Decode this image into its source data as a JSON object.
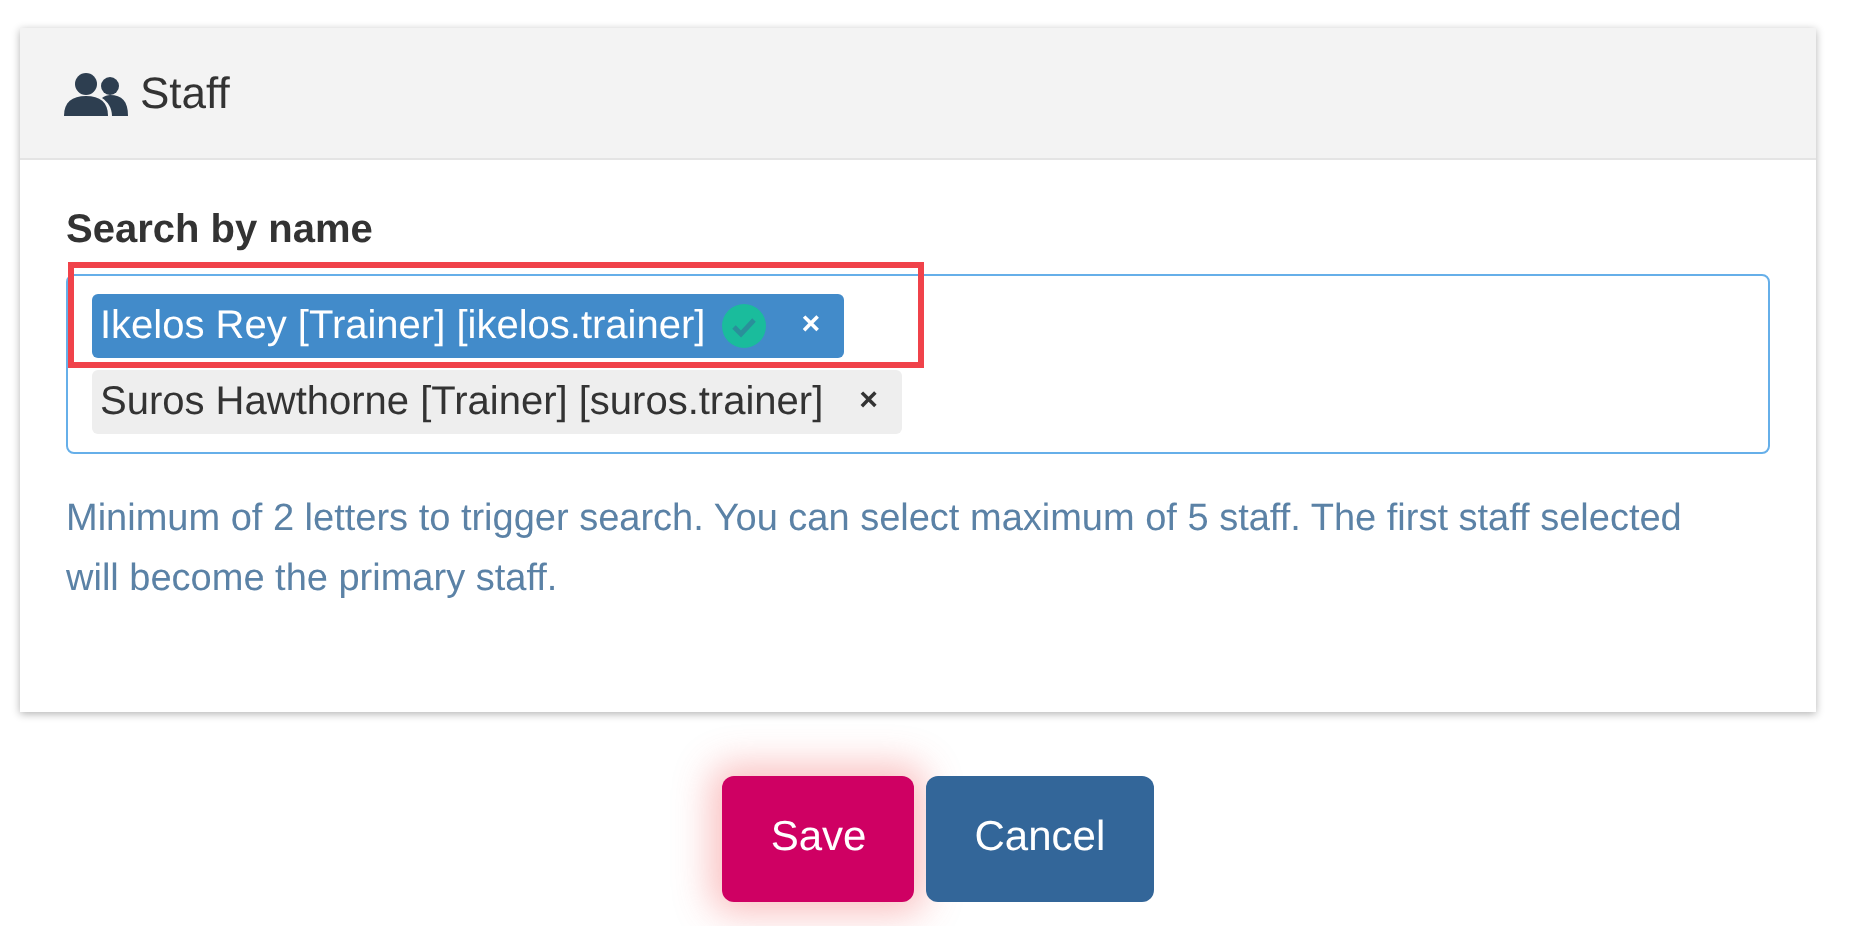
{
  "panel": {
    "title": "Staff"
  },
  "field": {
    "label": "Search by name",
    "tags": [
      {
        "text": "Ikelos Rey [Trainer] [ikelos.trainer]",
        "remove": "×",
        "selected": true,
        "primary": true,
        "highlighted": true
      },
      {
        "text": "Suros Hawthorne [Trainer] [suros.trainer]",
        "remove": "×",
        "selected": false,
        "primary": false,
        "highlighted": false
      }
    ],
    "help": "Minimum of 2 letters to trigger search. You can select maximum of 5 staff. The first staff selected will become the primary staff."
  },
  "buttons": [
    {
      "label": "Save",
      "kind": "primary"
    },
    {
      "label": "Cancel",
      "kind": "secondary"
    }
  ]
}
